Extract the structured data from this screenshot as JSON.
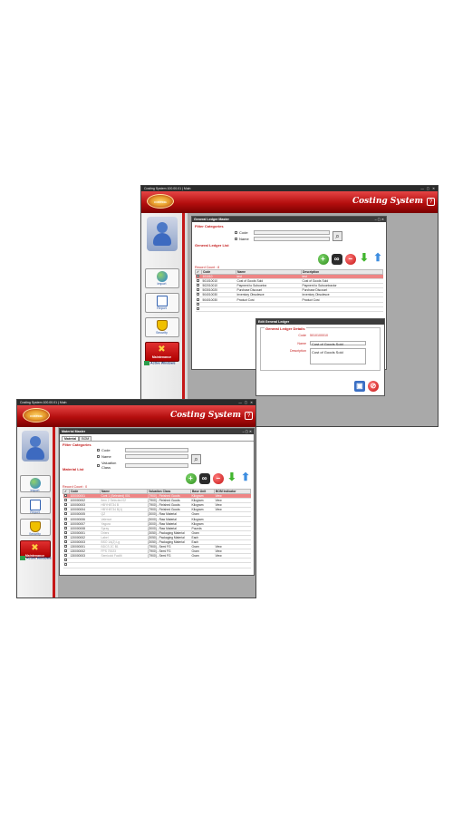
{
  "window1": {
    "title": "Costing System 100.00.01 | Main",
    "app_title": "Costing System",
    "logo_text": "COSTING",
    "sidebar": [
      {
        "label": "Import",
        "icon": "globe-icon"
      },
      {
        "label": "Report",
        "icon": "report-icon"
      },
      {
        "label": "Security",
        "icon": "shield-icon"
      },
      {
        "label": "Maintenance",
        "icon": "tools-icon"
      }
    ],
    "active_windows": "Active Windows",
    "gl_master": {
      "title": "General Ledger Master",
      "filter_section": "Filter Categories",
      "filter_code": "Code",
      "filter_name": "Name",
      "list_section": "General Ledger List",
      "record_count": "Record Count : 8",
      "columns": [
        "Code",
        "Name",
        "Description"
      ],
      "rows": [
        [
          "101010",
          "test",
          "test"
        ],
        [
          "501010010",
          "Cost of Goods Sold",
          "Cost of Goods Sold"
        ],
        [
          "502010010",
          "Payment to Subcontra",
          "Payment to Subcontractor"
        ],
        [
          "503010020",
          "Purchase Discount",
          "Purchase Discount"
        ],
        [
          "504010030",
          "Inventory Obsolesce",
          "Inventory Obsolesce"
        ],
        [
          "504010030",
          "Product Cost",
          "Product Cost"
        ],
        [
          "",
          "",
          ""
        ],
        [
          "",
          "",
          ""
        ]
      ]
    },
    "edit_gl": {
      "title": "Edit General Ledger",
      "section": "General Ledger Details",
      "code_label": "Code",
      "code_value": "5010100010",
      "name_label": "Name",
      "name_value": "Cost of Goods Sold",
      "desc_label": "Description",
      "desc_value": "Cost of Goods Sold"
    }
  },
  "window2": {
    "title": "Costing System 100.00.01 | Main",
    "app_title": "Costing System",
    "logo_text": "COSTING",
    "sidebar": [
      {
        "label": "Import",
        "icon": "globe-icon"
      },
      {
        "label": "Report",
        "icon": "report-icon"
      },
      {
        "label": "Security",
        "icon": "shield-icon"
      },
      {
        "label": "Maintenance",
        "icon": "tools-icon"
      }
    ],
    "active_windows": "Active Windows",
    "material_master": {
      "title": "Material Master",
      "tabs": [
        "Material",
        "BOM"
      ],
      "filter_section": "Filter Categories",
      "filter_code": "Code",
      "filter_name": "Name",
      "filter_valuation": "Valuation Class",
      "list_section": "Material List",
      "record_count": "Record Count : 0",
      "columns": [
        "Code",
        "Name",
        "Valuation Class",
        "Base Unit",
        "BOM Indicator"
      ],
      "rows": [
        [
          "100000001",
          "Cont 1 (Selected) 001",
          "[7900] - Finished Goods",
          "Kilogram",
          "View"
        ],
        [
          "100000002",
          "Item 2 Selected 02",
          "[7900] - Finished Goods",
          "Kilogram",
          "View"
        ],
        [
          "100000003",
          "HBYH8734 B",
          "[7900] - Finished Goods",
          "Kilogram",
          "View"
        ],
        [
          "100000004",
          "HBYH8734 B(1)",
          "[7900] - Finished Goods",
          "Kilogram",
          "View"
        ],
        [
          "100000005",
          "QZ",
          "[3000] - Raw Material",
          "Gram",
          ""
        ],
        [
          "100000006",
          "Valence",
          "[3000] - Raw Material",
          "Kilogram",
          ""
        ],
        [
          "100000007",
          "Yagura",
          "[3000] - Raw Material",
          "Kilogram",
          ""
        ],
        [
          "100000008",
          "Spray",
          "[3000] - Raw Material",
          "Pounds",
          ""
        ],
        [
          "120000001",
          "Driers",
          "[3050] - Packaging Material",
          "Gram",
          ""
        ],
        [
          "120000002",
          "Label",
          "[3050] - Packaging Material",
          "Each",
          ""
        ],
        [
          "120000003",
          "BSO 1A(2) Lg",
          "[3050] - Packaging Material",
          "Each",
          ""
        ],
        [
          "130000001",
          "BDCS 2C B1",
          "[7900] - Semi FG",
          "Gram",
          "View"
        ],
        [
          "130000002",
          "FPS 70023",
          "[7900] - Semi FG",
          "Gram",
          "View"
        ],
        [
          "130000003",
          "Semicold Facilit",
          "[7900] - Semi FG",
          "Gram",
          "View"
        ],
        [
          "",
          "",
          "",
          "",
          ""
        ],
        [
          "",
          "",
          "",
          "",
          ""
        ]
      ]
    }
  }
}
